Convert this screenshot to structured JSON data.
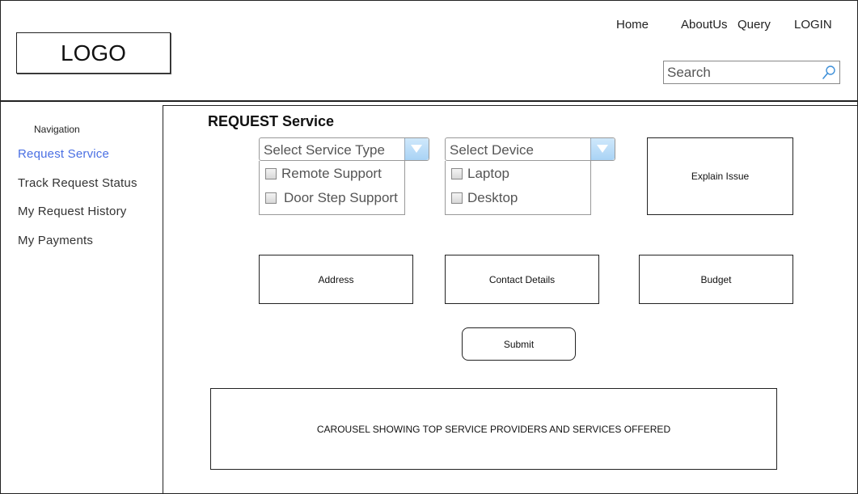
{
  "header": {
    "logo_text": "LOGO",
    "nav": {
      "home": "Home",
      "about": "AboutUs",
      "query": "Query",
      "login": "LOGIN"
    },
    "search": {
      "placeholder": "Search",
      "value": ""
    }
  },
  "sidebar": {
    "title": "Navigation",
    "items": [
      {
        "label": "Request Service",
        "active": true
      },
      {
        "label": "Track Request Status",
        "active": false
      },
      {
        "label": "My Request History",
        "active": false
      },
      {
        "label": "My Payments",
        "active": false
      }
    ]
  },
  "main": {
    "title": "REQUEST Service",
    "service_type": {
      "label": "Select Service Type",
      "options": [
        "Remote Support",
        "Door Step Support"
      ]
    },
    "device": {
      "label": "Select Device",
      "options": [
        "Laptop",
        "Desktop"
      ]
    },
    "fields": {
      "explain_issue": "Explain Issue",
      "address": "Address",
      "contact_details": "Contact Details",
      "budget": "Budget"
    },
    "submit_label": "Submit",
    "carousel_text": "CAROUSEL SHOWING TOP SERVICE PROVIDERS AND SERVICES OFFERED"
  },
  "colors": {
    "active_link": "#4a6fe3",
    "search_icon": "#3d8fd8",
    "dropdown_button": "#a9d3f5"
  }
}
